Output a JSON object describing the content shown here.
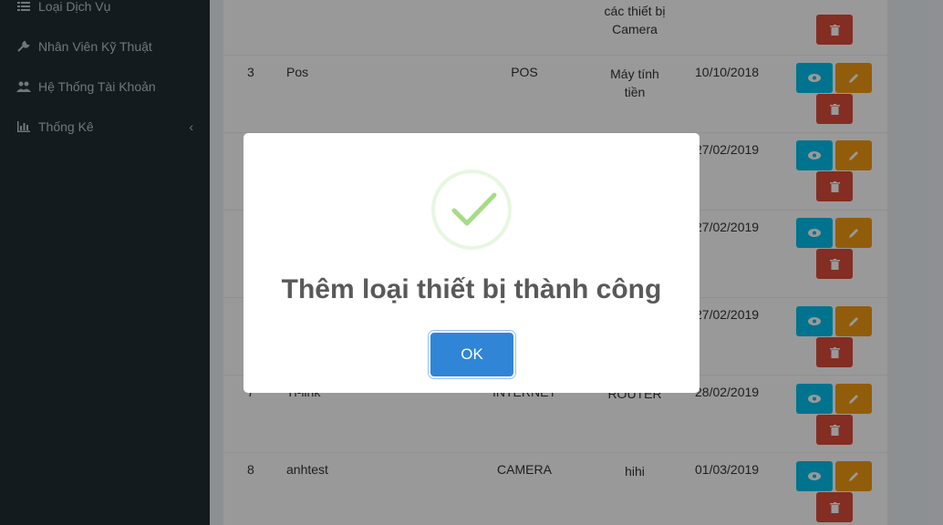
{
  "sidebar": {
    "items": [
      {
        "label": "Loại Dịch Vụ",
        "icon": "list-icon"
      },
      {
        "label": "Nhân Viên Kỹ Thuật",
        "icon": "wrench-icon"
      },
      {
        "label": "Hệ Thống Tài Khoản",
        "icon": "users-icon"
      },
      {
        "label": "Thống Kê",
        "icon": "bar-chart-icon"
      }
    ]
  },
  "table": {
    "rows": [
      {
        "index": "",
        "name": "",
        "code": "",
        "type_line1": "các thiết bị",
        "type_line2": "Camera",
        "date": ""
      },
      {
        "index": "3",
        "name": "Pos",
        "code": "POS",
        "type_line1": "Máy tính",
        "type_line2": "tiền",
        "date": "10/10/2018"
      },
      {
        "index": "",
        "name": "",
        "code": "",
        "type_line1": "",
        "type_line2": "",
        "date": "27/02/2019"
      },
      {
        "index": "",
        "name": "",
        "code": "",
        "type_line1": "",
        "type_line2": "",
        "date": "27/02/2019"
      },
      {
        "index": "",
        "name": "",
        "code": "",
        "type_line1": "",
        "type_line2": "",
        "date": "27/02/2019"
      },
      {
        "index": "7",
        "name": "Tl-link",
        "code": "INTERNET",
        "type_line1": "ROUTER",
        "type_line2": "",
        "date": "28/02/2019"
      },
      {
        "index": "8",
        "name": "anhtest",
        "code": "CAMERA",
        "type_line1": "hihi",
        "type_line2": "",
        "date": "01/03/2019"
      }
    ]
  },
  "modal": {
    "title": "Thêm loại thiết bị thành công",
    "ok_label": "OK",
    "icon": "success-check-icon",
    "check_color": "#a5dc86"
  }
}
